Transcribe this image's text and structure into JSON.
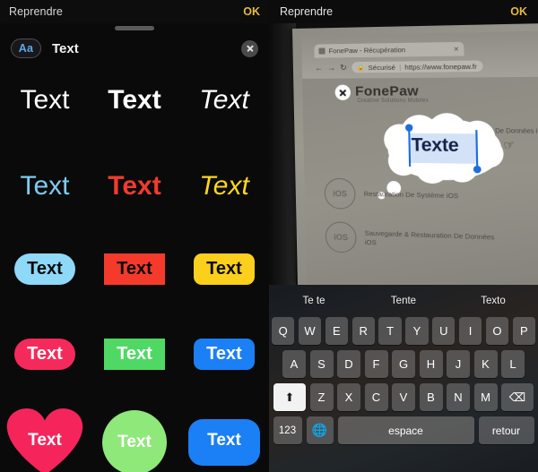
{
  "left_panel": {
    "navbar": {
      "back_label": "Reprendre",
      "confirm_label": "OK"
    },
    "toolbar": {
      "font_button": "Aa",
      "title": "Text",
      "close_icon": "close-icon"
    },
    "style_rows": [
      {
        "row": 1,
        "cells": [
          {
            "label": "Text",
            "style": "regular",
            "color": "#ffffff"
          },
          {
            "label": "Text",
            "style": "bold",
            "color": "#ffffff"
          },
          {
            "label": "Text",
            "style": "italic",
            "color": "#ffffff"
          }
        ]
      },
      {
        "row": 2,
        "cells": [
          {
            "label": "Text",
            "style": "regular",
            "color": "#7ecbf0"
          },
          {
            "label": "Text",
            "style": "bold",
            "color": "#f03b2e"
          },
          {
            "label": "Text",
            "style": "italic",
            "color": "#fcd71f"
          }
        ]
      },
      {
        "row": 3,
        "cells": [
          {
            "label": "Text",
            "shape": "pill",
            "bg": "#8ed8f8",
            "color": "#0a0a0a"
          },
          {
            "label": "Text",
            "shape": "rect",
            "bg": "#f53a2c",
            "color": "#0a0a0a"
          },
          {
            "label": "Text",
            "shape": "round",
            "bg": "#fbcf1b",
            "color": "#0a0a0a"
          }
        ]
      },
      {
        "row": 4,
        "cells": [
          {
            "label": "Text",
            "shape": "pill",
            "bg": "#f52a5c",
            "color": "#ffffff"
          },
          {
            "label": "Text",
            "shape": "rect",
            "bg": "#4fd964",
            "color": "#ffffff"
          },
          {
            "label": "Text",
            "shape": "round",
            "bg": "#1b7ff5",
            "color": "#ffffff"
          }
        ]
      },
      {
        "row": 5,
        "cells": [
          {
            "label": "Text",
            "shape": "heart",
            "bg": "#f5255c",
            "color": "#ffffff"
          },
          {
            "label": "Text",
            "shape": "circle",
            "bg": "#8ee87a",
            "color": "#ffffff"
          },
          {
            "label": "Text",
            "shape": "bubble",
            "bg": "#1b7ff5",
            "color": "#ffffff"
          }
        ]
      }
    ]
  },
  "right_panel": {
    "navbar": {
      "back_label": "Reprendre",
      "confirm_label": "OK"
    },
    "browser": {
      "tab_title": "FonePaw - Récupération",
      "tab_close_icon": "close-icon",
      "back_icon": "arrow-left-icon",
      "forward_icon": "arrow-right-icon",
      "reload_icon": "reload-icon",
      "lock_icon": "lock-icon",
      "security_label": "Sécurisé",
      "url": "https://www.fonepaw.fr"
    },
    "page": {
      "brand": "FonePaw",
      "tagline": "Creative Solutions Mobiles",
      "close_icon": "close-icon",
      "hero_caption": "De Données iPhone",
      "cursor_icon": "pointer-hand-icon",
      "features": [
        {
          "icon_label": "iOS",
          "text": "Restauration De Système iOS"
        },
        {
          "icon_label": "iOS",
          "text": "Sauvegarde & Restauration De Données iOS"
        }
      ]
    },
    "text_edit": {
      "value": "Texte",
      "selection_color": "#1c6fe0",
      "bubble_shape": "thought-cloud"
    },
    "keyboard": {
      "suggestions": [
        "Te te",
        "Tente",
        "Texto"
      ],
      "row1": [
        "Q",
        "W",
        "E",
        "R",
        "T",
        "Y",
        "U",
        "I",
        "O",
        "P"
      ],
      "row2": [
        "A",
        "S",
        "D",
        "F",
        "G",
        "H",
        "J",
        "K",
        "L"
      ],
      "shift_icon": "shift-up-icon",
      "row3": [
        "Z",
        "X",
        "C",
        "V",
        "B",
        "N",
        "M"
      ],
      "backspace_icon": "backspace-icon",
      "numbers_label": "123",
      "globe_icon": "globe-icon",
      "space_label": "espace",
      "return_label": "retour"
    }
  }
}
